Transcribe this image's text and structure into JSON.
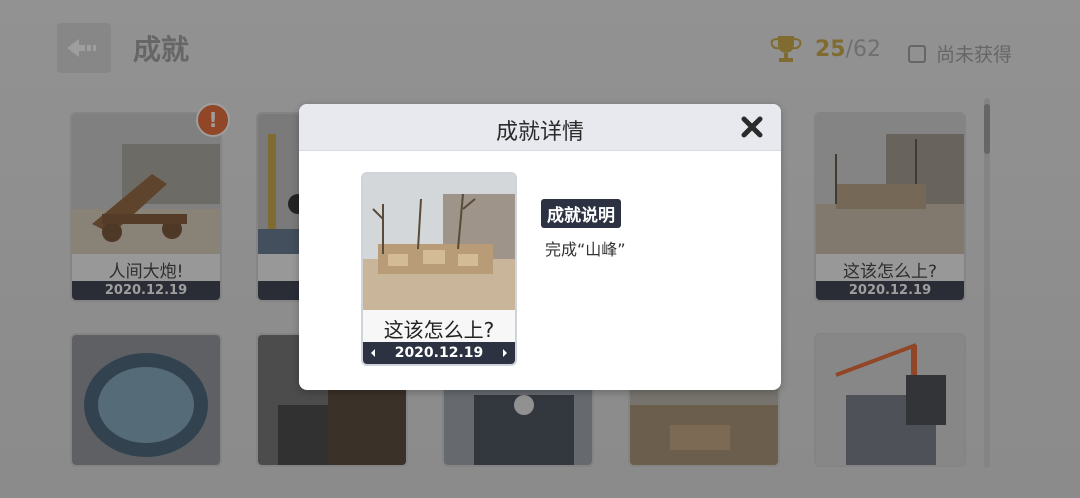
{
  "header": {
    "title": "成就",
    "earned": "25",
    "total": "/62",
    "filter_label": "尚未获得"
  },
  "grid": [
    {
      "name": "人间大炮!",
      "date": "2020.12.19"
    },
    {
      "name": "这该怎么上?",
      "date": "2020.12.19"
    },
    {
      "date_partial": "2"
    }
  ],
  "modal": {
    "title": "成就详情",
    "card_name": "这该怎么上?",
    "card_date": "2020.12.19",
    "desc_label": "成就说明",
    "desc_text": "完成“山峰”"
  },
  "colors": {
    "accent_dark": "#2c3242",
    "trophy_gold": "#c9a53a",
    "badge_orange": "#e85f28"
  },
  "icons": [
    "back-arrow-icon",
    "trophy-icon",
    "checkbox-icon",
    "close-icon",
    "alert-icon"
  ]
}
